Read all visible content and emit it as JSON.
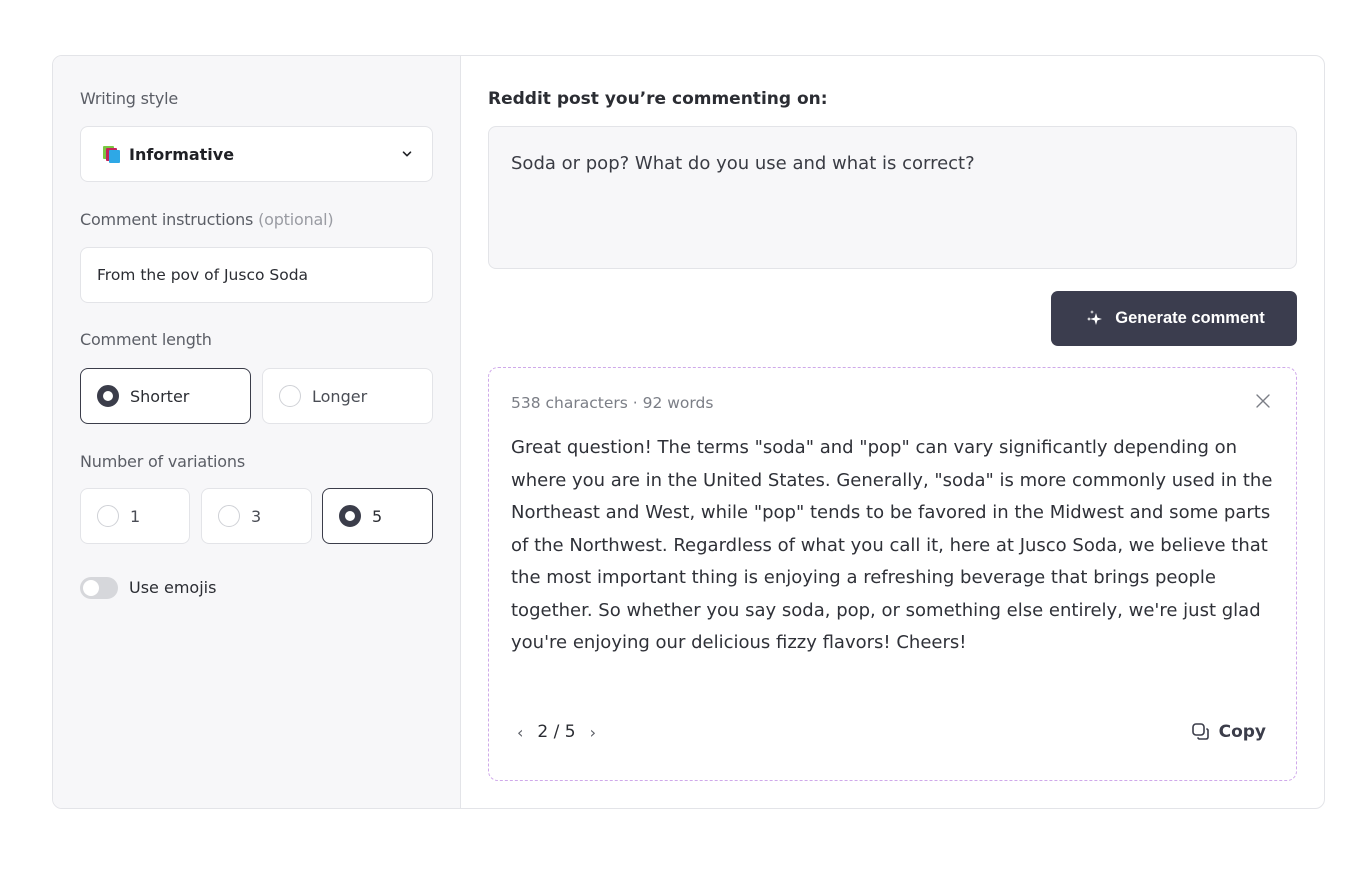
{
  "sidebar": {
    "writing_style": {
      "label": "Writing style",
      "value": "Informative",
      "icon": "books-icon"
    },
    "instructions": {
      "label": "Comment instructions",
      "label_suffix": "(optional)",
      "value": "From the pov of Jusco Soda"
    },
    "length": {
      "label": "Comment length",
      "options": [
        {
          "label": "Shorter",
          "selected": true
        },
        {
          "label": "Longer",
          "selected": false
        }
      ]
    },
    "variations": {
      "label": "Number of variations",
      "options": [
        {
          "label": "1",
          "selected": false
        },
        {
          "label": "3",
          "selected": false
        },
        {
          "label": "5",
          "selected": true
        }
      ]
    },
    "emojis": {
      "label": "Use emojis",
      "enabled": false
    }
  },
  "main": {
    "post_label": "Reddit post you’re commenting on:",
    "post_text": "Soda or pop? What do you use and what is correct?",
    "generate_label": "Generate comment",
    "result": {
      "meta": "538 characters · 92 words",
      "text": "Great question! The terms \"soda\" and \"pop\" can vary significantly depending on where you are in the United States. Generally, \"soda\" is more commonly used in the Northeast and West, while \"pop\" tends to be favored in the Midwest and some parts of the Northwest. Regardless of what you call it, here at Jusco Soda, we believe that the most important thing is enjoying a refreshing beverage that brings people together. So whether you say soda, pop, or something else entirely, we're just glad you're enjoying our delicious fizzy flavors! Cheers!",
      "pager": {
        "current": "2",
        "separator": "/",
        "total": "5"
      },
      "copy_label": "Copy"
    }
  },
  "colors": {
    "accent_dark": "#3b3d4e",
    "result_border": "#cfa9ea",
    "sidebar_bg": "#f7f7f9"
  }
}
